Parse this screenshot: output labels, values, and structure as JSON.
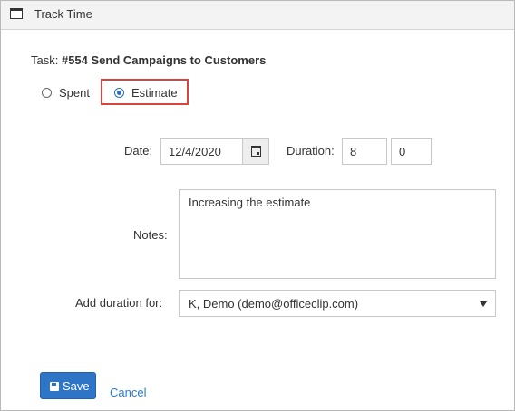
{
  "window": {
    "title": "Track Time",
    "icon": "window-icon"
  },
  "task": {
    "prefix": "Task:",
    "name": "#554 Send Campaigns to Customers"
  },
  "mode": {
    "options": [
      {
        "label": "Spent",
        "checked": false
      },
      {
        "label": "Estimate",
        "checked": true
      }
    ]
  },
  "form": {
    "date_label": "Date:",
    "date_value": "12/4/2020",
    "duration_label": "Duration:",
    "duration_hours": "8",
    "duration_minutes": "0",
    "notes_label": "Notes:",
    "notes_value": "Increasing the estimate",
    "add_duration_label": "Add duration for:",
    "add_duration_value": "K, Demo (demo@officeclip.com)"
  },
  "actions": {
    "save_label": "Save",
    "cancel_label": "Cancel"
  },
  "colors": {
    "accent": "#2e75c8",
    "highlight": "#d9443f",
    "link": "#2a7bd1"
  }
}
